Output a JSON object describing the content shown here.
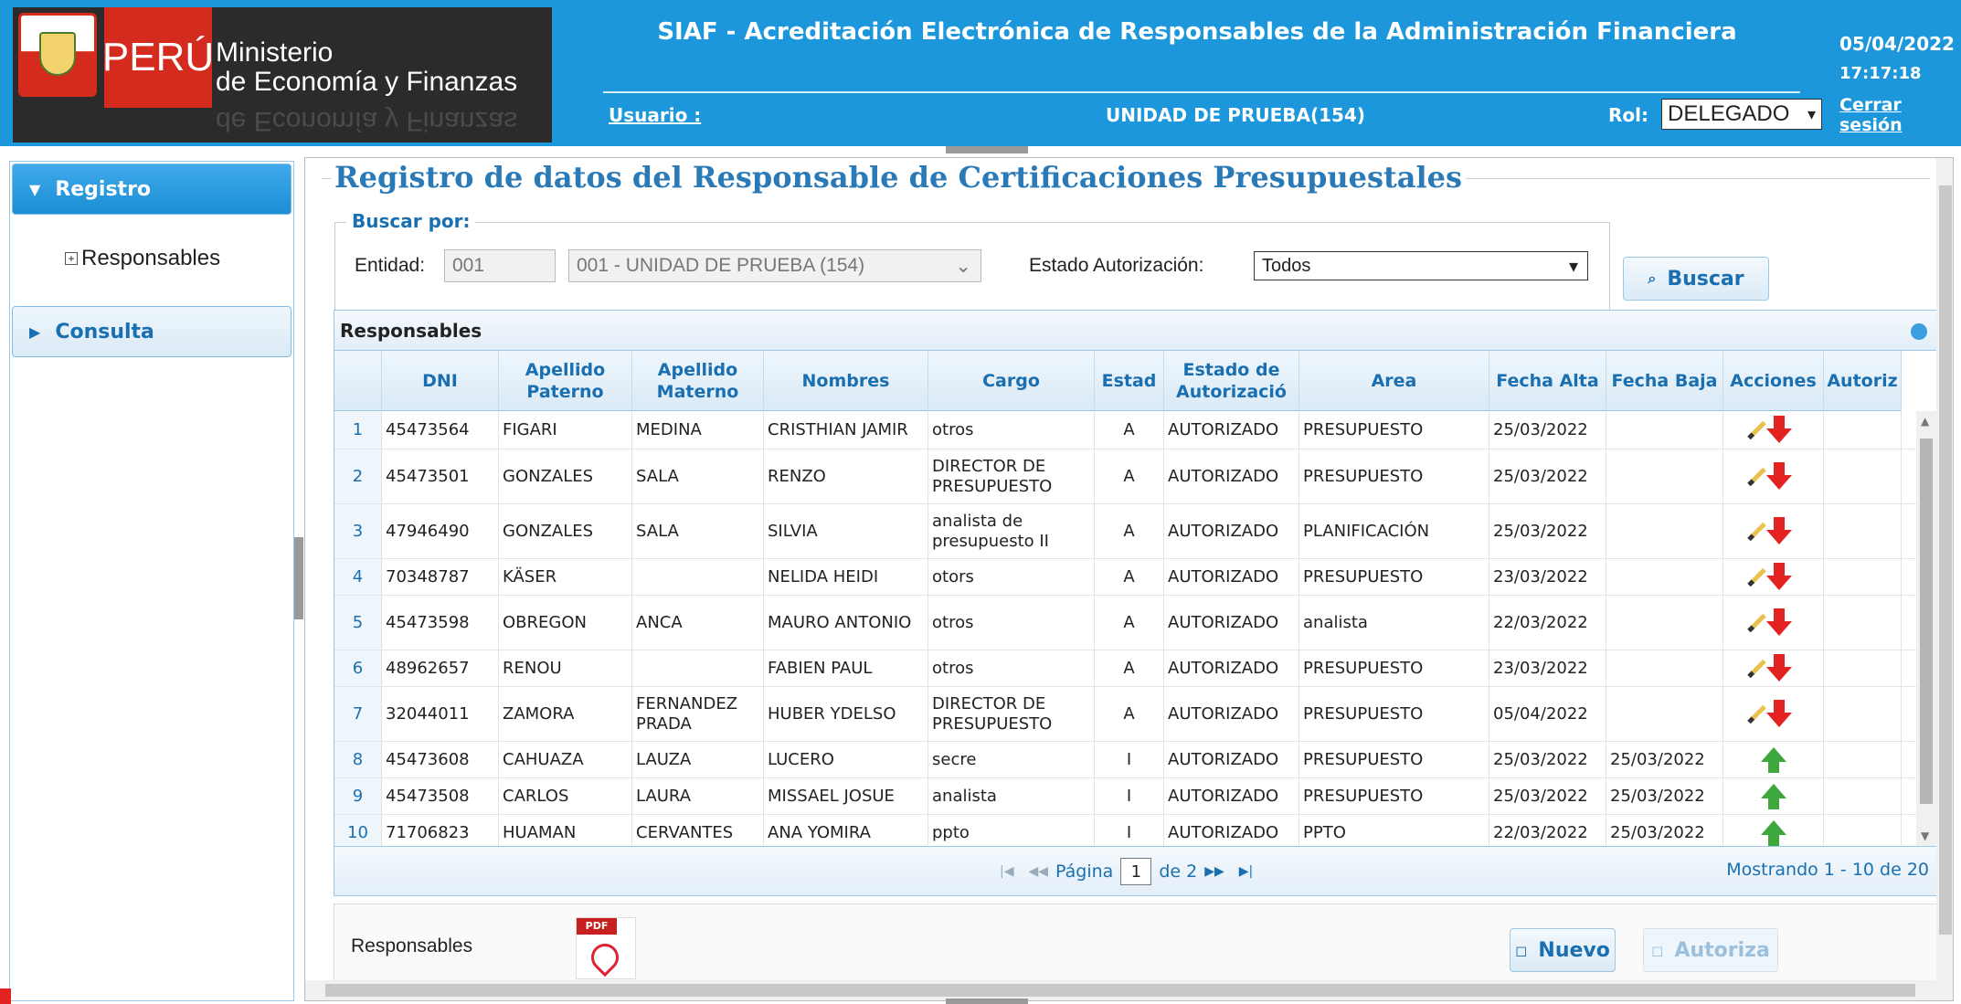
{
  "header": {
    "country": "PERÚ",
    "ministry_line1": "Ministerio",
    "ministry_line2": "de Economía y Finanzas",
    "app_title": "SIAF - Acreditación Electrónica de Responsables de la Administración Financiera",
    "user_label": "Usuario :",
    "user_value": "UNIDAD DE PRUEBA(154)",
    "rol_label": "Rol:",
    "rol_value": "DELEGADO",
    "date": "05/04/2022",
    "time": "17:17:18",
    "logout": "Cerrar sesión",
    "colors": {
      "header_bg": "#1c97dc",
      "flag_red": "#d52b1e"
    }
  },
  "sidebar": {
    "sections": [
      {
        "label": "Registro",
        "expanded": true,
        "items": [
          {
            "label": "Responsables"
          }
        ]
      },
      {
        "label": "Consulta",
        "expanded": false,
        "items": []
      }
    ]
  },
  "main": {
    "title": "Registro de datos del Responsable de Certificaciones Presupuestales",
    "search": {
      "legend": "Buscar por:",
      "entidad_label": "Entidad:",
      "entidad_code": "001",
      "entidad_name": "001 - UNIDAD DE PRUEBA (154)",
      "estado_label": "Estado Autorización:",
      "estado_value": "Todos",
      "buscar_button": "Buscar"
    },
    "grid": {
      "caption": "Responsables",
      "columns": [
        "",
        "DNI",
        "Apellido Paterno",
        "Apellido Materno",
        "Nombres",
        "Cargo",
        "Estad",
        "Estado de Autorizació",
        "Area",
        "Fecha Alta",
        "Fecha Baja",
        "Acciones",
        "Autoriz"
      ],
      "rows": [
        {
          "n": "1",
          "dni": "45473564",
          "paterno": "FIGARI",
          "materno": "MEDINA",
          "nombres": "CRISTHIAN JAMIR",
          "cargo": "otros",
          "estado": "A",
          "autorizacion": "AUTORIZADO",
          "area": "PRESUPUESTO",
          "alta": "25/03/2022",
          "baja": "",
          "accion": "edit-baja"
        },
        {
          "n": "2",
          "dni": "45473501",
          "paterno": "GONZALES",
          "materno": "SALA",
          "nombres": "RENZO",
          "cargo": "DIRECTOR DE PRESUPUESTO",
          "estado": "A",
          "autorizacion": "AUTORIZADO",
          "area": "PRESUPUESTO",
          "alta": "25/03/2022",
          "baja": "",
          "accion": "edit-baja"
        },
        {
          "n": "3",
          "dni": "47946490",
          "paterno": "GONZALES",
          "materno": "SALA",
          "nombres": "SILVIA",
          "cargo": "analista de presupuesto II",
          "estado": "A",
          "autorizacion": "AUTORIZADO",
          "area": "PLANIFICACIÓN",
          "alta": "25/03/2022",
          "baja": "",
          "accion": "edit-baja"
        },
        {
          "n": "4",
          "dni": "70348787",
          "paterno": "KÄSER",
          "materno": "",
          "nombres": "NELIDA HEIDI",
          "cargo": "otors",
          "estado": "A",
          "autorizacion": "AUTORIZADO",
          "area": "PRESUPUESTO",
          "alta": "23/03/2022",
          "baja": "",
          "accion": "edit-baja"
        },
        {
          "n": "5",
          "dni": "45473598",
          "paterno": "OBREGON",
          "materno": "ANCA",
          "nombres": "MAURO ANTONIO",
          "cargo": "otros",
          "estado": "A",
          "autorizacion": "AUTORIZADO",
          "area": "analista",
          "alta": "22/03/2022",
          "baja": "",
          "accion": "edit-baja"
        },
        {
          "n": "6",
          "dni": "48962657",
          "paterno": "RENOU",
          "materno": "",
          "nombres": "FABIEN PAUL",
          "cargo": "otros",
          "estado": "A",
          "autorizacion": "AUTORIZADO",
          "area": "PRESUPUESTO",
          "alta": "23/03/2022",
          "baja": "",
          "accion": "edit-baja"
        },
        {
          "n": "7",
          "dni": "32044011",
          "paterno": "ZAMORA",
          "materno": "FERNANDEZ PRADA",
          "nombres": "HUBER YDELSO",
          "cargo": "DIRECTOR DE PRESUPUESTO",
          "estado": "A",
          "autorizacion": "AUTORIZADO",
          "area": "PRESUPUESTO",
          "alta": "05/04/2022",
          "baja": "",
          "accion": "edit-baja"
        },
        {
          "n": "8",
          "dni": "45473608",
          "paterno": "CAHUAZA",
          "materno": "LAUZA",
          "nombres": "LUCERO",
          "cargo": "secre",
          "estado": "I",
          "autorizacion": "AUTORIZADO",
          "area": "PRESUPUESTO",
          "alta": "25/03/2022",
          "baja": "25/03/2022",
          "accion": "alta"
        },
        {
          "n": "9",
          "dni": "45473508",
          "paterno": "CARLOS",
          "materno": "LAURA",
          "nombres": "MISSAEL JOSUE",
          "cargo": "analista",
          "estado": "I",
          "autorizacion": "AUTORIZADO",
          "area": "PRESUPUESTO",
          "alta": "25/03/2022",
          "baja": "25/03/2022",
          "accion": "alta"
        },
        {
          "n": "10",
          "dni": "71706823",
          "paterno": "HUAMAN",
          "materno": "CERVANTES",
          "nombres": "ANA YOMIRA",
          "cargo": "ppto",
          "estado": "I",
          "autorizacion": "AUTORIZADO",
          "area": "PPTO",
          "alta": "22/03/2022",
          "baja": "25/03/2022",
          "accion": "alta"
        }
      ],
      "pager": {
        "page_label": "Página",
        "page": "1",
        "of_label": "de 2",
        "records": "Mostrando 1 - 10 de 20"
      }
    },
    "footer": {
      "label": "Responsables",
      "pdf_tag": "PDF",
      "nuevo_button": "Nuevo",
      "autoriza_button": "Autoriza"
    }
  }
}
